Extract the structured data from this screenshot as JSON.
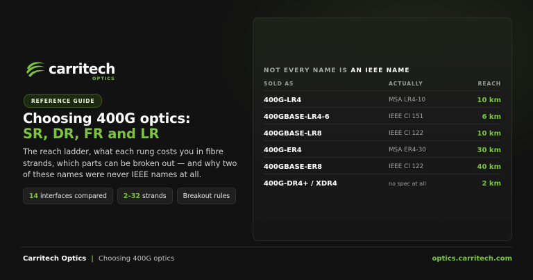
{
  "brand": {
    "logo_word": "carritech",
    "logo_sub": "OPTICS",
    "accent": "#7dc242"
  },
  "badge": "REFERENCE GUIDE",
  "title": {
    "line1": "Choosing 400G optics:",
    "line2": "SR, DR, FR and LR"
  },
  "description": "The reach ladder, what each rung costs you in fibre strands, which parts can be broken out — and why two of these names were never IEEE names at all.",
  "chips": [
    {
      "highlight": "14",
      "text": "interfaces compared"
    },
    {
      "highlight": "2–32",
      "text": "strands"
    },
    {
      "highlight": "",
      "text": "Breakout rules"
    }
  ],
  "card": {
    "heading_plain": "NOT EVERY NAME IS ",
    "heading_emph": "AN IEEE NAME",
    "columns": {
      "sold_as": "SOLD AS",
      "actually": "ACTUALLY",
      "reach": "REACH"
    },
    "rows": [
      {
        "sold_as": "400G-LR4",
        "actually": "MSA LR4-10",
        "reach": "10 km"
      },
      {
        "sold_as": "400GBASE-LR4-6",
        "actually": "IEEE Cl 151",
        "reach": "6 km"
      },
      {
        "sold_as": "400GBASE-LR8",
        "actually": "IEEE Cl 122",
        "reach": "10 km"
      },
      {
        "sold_as": "400G-ER4",
        "actually": "MSA ER4-30",
        "reach": "30 km"
      },
      {
        "sold_as": "400GBASE-ER8",
        "actually": "IEEE Cl 122",
        "reach": "40 km"
      },
      {
        "sold_as": "400G-DR4+ / XDR4",
        "actually": "no spec at all",
        "reach": "2 km"
      }
    ]
  },
  "footer": {
    "brand": "Carritech Optics",
    "separator": "|",
    "page": "Choosing 400G optics",
    "url": "optics.carritech.com"
  }
}
